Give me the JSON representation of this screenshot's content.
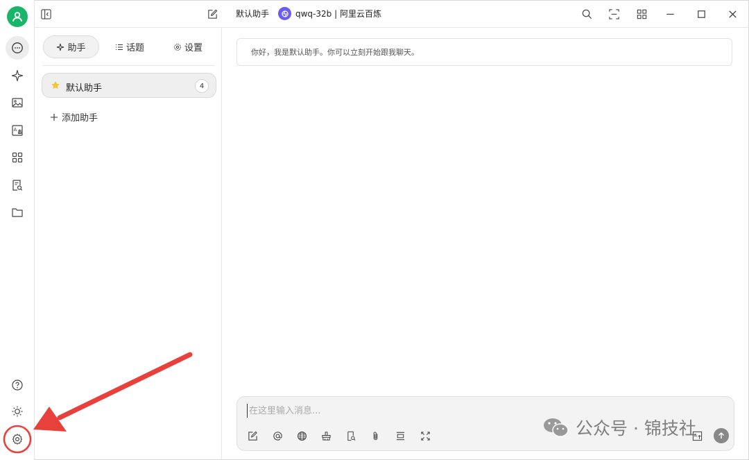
{
  "titlebar": {
    "assistant_title": "默认助手",
    "model_name": "qwq-32b | 阿里云百炼"
  },
  "rail": {
    "icons": [
      "user-avatar",
      "chat-icon",
      "sparkle-icon",
      "image-icon",
      "translate-icon",
      "apps-icon",
      "document-search-icon",
      "folder-icon",
      "help-icon",
      "theme-sun-icon",
      "settings-gear-icon"
    ]
  },
  "panel": {
    "tabs": [
      {
        "label": "助手",
        "active": true
      },
      {
        "label": "话题",
        "active": false
      },
      {
        "label": "设置",
        "active": false
      }
    ],
    "assistant": {
      "name": "默认助手",
      "count": "4"
    },
    "add_label": "添加助手"
  },
  "chat": {
    "greeting": "你好，我是默认助手。你可以立刻开始跟我聊天。",
    "input_placeholder": "在这里输入消息..."
  },
  "watermark": {
    "text": "公众号 · 锦技社"
  },
  "colors": {
    "accent_green": "#19b56b",
    "model_logo": "#6a5cf0",
    "highlight_red": "#e8413c",
    "star_yellow": "#f4c430"
  }
}
